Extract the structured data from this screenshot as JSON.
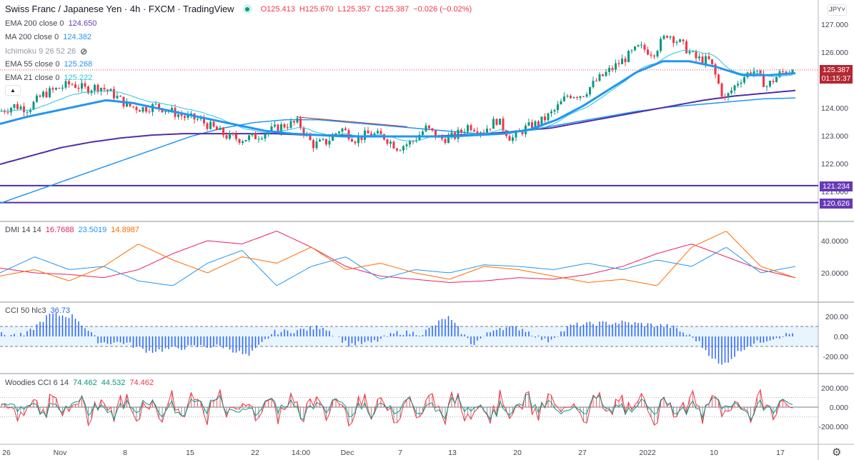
{
  "header": {
    "title": "Swiss Franc / Japanese Yen · 4h · FXCM · TradingView",
    "ohlc": {
      "o": "O125.413",
      "h": "H125.670",
      "l": "L125.357",
      "c": "C125.387",
      "chg": "−0.026 (−0.02%)"
    }
  },
  "legends": [
    {
      "label": "EMA 200 close 0",
      "value": "124.650",
      "color": "#673ab7"
    },
    {
      "label": "MA 200 close 0",
      "value": "124.382",
      "color": "#2196f3"
    },
    {
      "label": "Ichimoku 9 26 52 26",
      "value": "",
      "color": "#9598a1"
    },
    {
      "label": "EMA 55 close 0",
      "value": "125.268",
      "color": "#2196f3"
    },
    {
      "label": "EMA 21 close 0",
      "value": "125.222",
      "color": "#26c6da"
    }
  ],
  "currency": "JPY",
  "price_axis": [
    "127.000",
    "126.000",
    "125.000",
    "124.000",
    "123.000",
    "122.000",
    "121.000"
  ],
  "price_tags": {
    "last": "125.387",
    "countdown": "01:15:37",
    "line1": "121.234",
    "line2": "120.626"
  },
  "dmi": {
    "label": "DMI 14 14",
    "v1": "16.7688",
    "v2": "23.5019",
    "v3": "14.8987",
    "axis": [
      "40.0000",
      "20.0000"
    ]
  },
  "cci": {
    "label": "CCI 50 hlc3",
    "value": "36.73",
    "axis": [
      "200.00",
      "0.00",
      "-200.00"
    ]
  },
  "woodies": {
    "label": "Woodies CCI 6 14",
    "v1": "74.462",
    "v2": "44.532",
    "v3": "74.462",
    "axis": [
      "200.000",
      "0.000",
      "-200.000"
    ]
  },
  "time_axis": [
    "26",
    "Nov",
    "8",
    "15",
    "22",
    "14:00",
    "Dec",
    "7",
    "13",
    "20",
    "27",
    "2022",
    "10",
    "17"
  ],
  "chart_data": {
    "type": "candlestick",
    "close": [
      123.9,
      124.1,
      124.0,
      124.5,
      124.7,
      124.9,
      124.7,
      124.8,
      124.5,
      124.1,
      124.0,
      124.1,
      123.9,
      123.7,
      123.6,
      123.3,
      123.0,
      122.9,
      123.0,
      123.2,
      123.4,
      123.5,
      122.7,
      122.8,
      123.3,
      122.9,
      123.1,
      123.0,
      122.6,
      122.8,
      123.3,
      122.9,
      123.0,
      123.4,
      123.2,
      123.6,
      122.9,
      123.3,
      123.5,
      123.9,
      124.5,
      124.5,
      125.0,
      125.4,
      125.8,
      126.2,
      126.0,
      126.7,
      126.3,
      125.8,
      125.7,
      124.3,
      125.0,
      125.4,
      124.8,
      125.3,
      125.387
    ],
    "ema55": [
      123.45,
      123.7,
      123.9,
      124.1,
      124.3,
      124.2,
      124.0,
      123.8,
      123.6,
      123.4,
      123.2,
      123.1,
      123.05,
      123.0,
      123.0,
      123.0,
      123.0,
      123.0,
      123.05,
      123.1,
      123.25,
      123.6,
      124.1,
      124.7,
      125.3,
      125.7,
      125.7,
      125.5,
      125.2,
      125.2,
      125.27
    ],
    "ema200": [
      122.0,
      122.3,
      122.6,
      122.8,
      122.95,
      123.05,
      123.1,
      123.1,
      123.1,
      123.1,
      123.05,
      123.05,
      123.0,
      123.0,
      123.0,
      123.05,
      123.1,
      123.2,
      123.3,
      123.5,
      123.7,
      123.9,
      124.1,
      124.3,
      124.45,
      124.55,
      124.65
    ],
    "ma200": [
      120.6,
      121.0,
      121.4,
      121.8,
      122.2,
      122.6,
      123.0,
      123.3,
      123.5,
      123.6,
      123.6,
      123.5,
      123.4,
      123.3,
      123.2,
      123.1,
      123.15,
      123.3,
      123.5,
      123.7,
      123.9,
      124.05,
      124.15,
      124.25,
      124.35,
      124.38
    ],
    "hlines": [
      121.234,
      120.626
    ],
    "trendline": [
      123.7,
      123.35
    ],
    "dmi_adx": [
      23,
      20,
      19,
      17,
      22,
      32,
      40,
      38,
      46,
      36,
      24,
      18,
      16,
      14,
      15,
      17,
      16,
      19,
      24,
      32,
      38,
      30,
      22,
      17
    ],
    "dmi_plus": [
      20,
      30,
      22,
      24,
      15,
      12,
      26,
      34,
      12,
      24,
      30,
      16,
      22,
      20,
      25,
      24,
      22,
      26,
      22,
      28,
      24,
      36,
      20,
      24
    ],
    "dmi_minus": [
      18,
      22,
      15,
      24,
      38,
      28,
      20,
      30,
      26,
      36,
      22,
      26,
      20,
      16,
      24,
      22,
      18,
      14,
      16,
      12,
      36,
      46,
      24,
      17
    ],
    "cci": [
      20,
      10,
      220,
      200,
      -60,
      -60,
      -150,
      -120,
      -100,
      -100,
      -200,
      40,
      60,
      100,
      -80,
      -60,
      40,
      30,
      200,
      -80,
      90,
      80,
      -50,
      110,
      130,
      140,
      120,
      100,
      -30,
      -300,
      -100,
      -20,
      37
    ]
  }
}
